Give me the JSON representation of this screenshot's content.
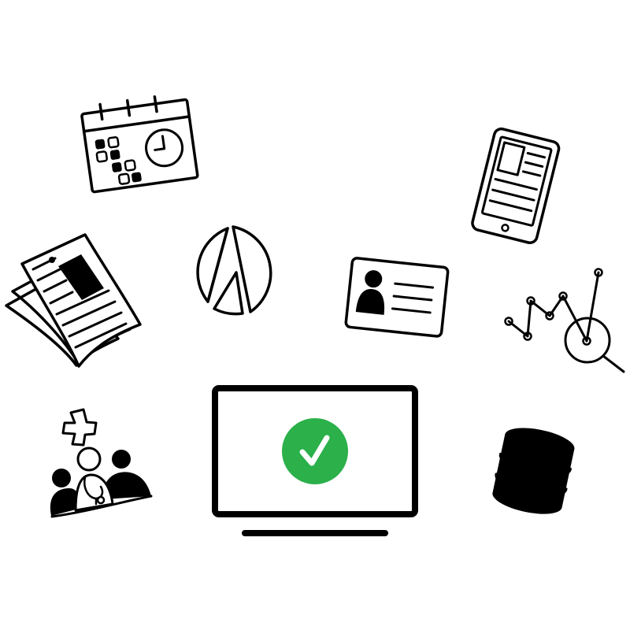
{
  "colors": {
    "stroke": "#000000",
    "background": "#ffffff",
    "accent": "#2bb04a",
    "check": "#ffffff"
  },
  "icons": [
    "calendar-clock-icon",
    "tablet-icon",
    "newspaper-icon",
    "pie-chart-icon",
    "id-card-icon",
    "line-chart-magnifier-icon",
    "doctor-patients-icon",
    "monitor-icon",
    "checkmark-icon",
    "database-icon"
  ]
}
